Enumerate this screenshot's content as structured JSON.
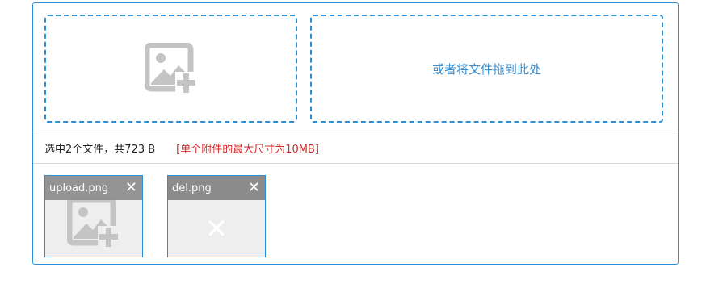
{
  "dropzone": {
    "text": "或者将文件拖到此处",
    "icon": "image-add-icon",
    "color": "#2e8fd4"
  },
  "status": {
    "selected": "选中2个文件，共723 B",
    "limit_note": "[单个附件的最大尺寸为10MB]",
    "limit_color": "#d12b2b"
  },
  "files": [
    {
      "name": "upload.png",
      "close_glyph": "✕",
      "thumb_icon": "image-add-icon"
    },
    {
      "name": "del.png",
      "close_glyph": "✕",
      "thumb_glyph": "✕"
    }
  ]
}
